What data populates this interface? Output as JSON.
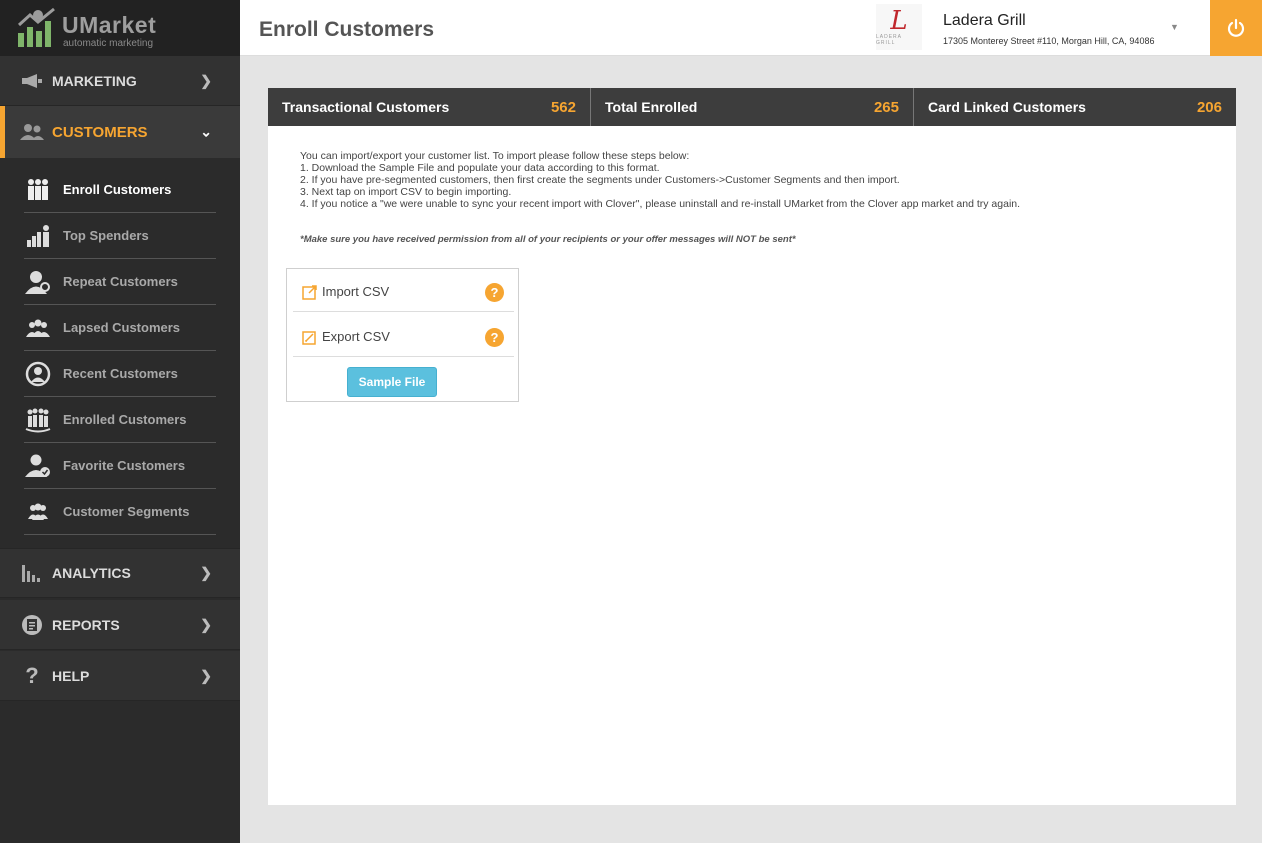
{
  "brand": {
    "name": "UMarket",
    "tagline": "automatic marketing"
  },
  "sidebar": {
    "marketing": {
      "label": "MARKETING",
      "icon": "megaphone-icon"
    },
    "customers": {
      "label": "CUSTOMERS",
      "icon": "users-icon",
      "items": [
        {
          "label": "Enroll Customers",
          "icon": "enroll-customers-icon",
          "active": true
        },
        {
          "label": "Top Spenders",
          "icon": "top-spenders-icon"
        },
        {
          "label": "Repeat Customers",
          "icon": "repeat-customers-icon"
        },
        {
          "label": "Lapsed Customers",
          "icon": "lapsed-customers-icon"
        },
        {
          "label": "Recent Customers",
          "icon": "recent-customers-icon"
        },
        {
          "label": "Enrolled Customers",
          "icon": "enrolled-customers-icon"
        },
        {
          "label": "Favorite Customers",
          "icon": "favorite-customers-icon"
        },
        {
          "label": "Customer Segments",
          "icon": "customer-segments-icon"
        }
      ]
    },
    "analytics": {
      "label": "ANALYTICS",
      "icon": "bar-chart-icon"
    },
    "reports": {
      "label": "REPORTS",
      "icon": "reports-icon"
    },
    "help": {
      "label": "HELP",
      "icon": "question-icon"
    }
  },
  "header": {
    "title": "Enroll Customers",
    "business": {
      "logo_letter": "L",
      "logo_text": "LADERA GRILL",
      "name": "Ladera Grill",
      "address": "17305 Monterey Street #110, Morgan Hill, CA, 94086"
    }
  },
  "stats": [
    {
      "label": "Transactional Customers",
      "value": "562"
    },
    {
      "label": "Total Enrolled",
      "value": "265"
    },
    {
      "label": "Card Linked Customers",
      "value": "206"
    }
  ],
  "instructions": {
    "intro": "You can import/export your customer list. To import please follow these steps below:",
    "steps": [
      "1. Download the Sample File and populate your data according to this format.",
      "2. If you have pre-segmented customers, then first create the segments under Customers->Customer Segments and then import.",
      "3. Next tap on import CSV to begin importing.",
      "4. If you notice a \"we were unable to sync your recent import with Clover\", please uninstall and re-install UMarket from the Clover app market and try again."
    ],
    "warning": "*Make sure you have received permission from all of your recipients or your offer messages will NOT be sent*"
  },
  "csv": {
    "import_label": "Import CSV",
    "export_label": "Export CSV",
    "help_glyph": "?",
    "sample_label": "Sample File"
  },
  "colors": {
    "accent": "#f6a531",
    "sidebar": "#2b2b2b",
    "button": "#5bc0de",
    "stats_bar": "#3d3d3d"
  }
}
